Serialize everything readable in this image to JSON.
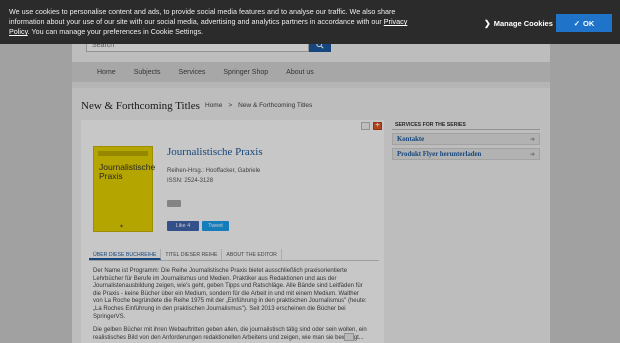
{
  "cookie": {
    "text_before_link": "We use cookies to personalise content and ads, to provide social media features and to analyse our traffic. We also share information about your use of our site with our social media, advertising and analytics partners in accordance with our ",
    "link": "Privacy Policy",
    "text_after_link": ". You can manage your preferences in Cookie Settings.",
    "manage_label": "Manage Cookies",
    "ok_label": "OK",
    "ok_color": "#1f73c9"
  },
  "search": {
    "placeholder": "Search"
  },
  "nav": [
    "Home",
    "Subjects",
    "Services",
    "Springer Shop",
    "About us"
  ],
  "page_title": "New & Forthcoming Titles",
  "breadcrumb": {
    "home": "Home",
    "sep": ">",
    "current": "New & Forthcoming Titles"
  },
  "book": {
    "cover_title": "Journalistische Praxis",
    "title": "Journalistische Praxis",
    "editor_line": "Reihen-Hrsg.: Hooffacker, Gabriele",
    "issn": "ISSN: 2524-3128",
    "fb_label": "Like 4",
    "tweet_label": "Tweet"
  },
  "tabs": [
    "ÜBER DIESE BUCHREIHE",
    "TITEL DIESER REIHE",
    "ABOUT THE EDITOR"
  ],
  "description": {
    "p1": "Der Name ist Programm: Die Reihe Journalistische Praxis bietet ausschließlich praxisorientierte Lehrbücher für Berufe im Journalismus und Medien. Praktiker aus Redaktionen und aus der Journalistenausbildung zeigen, wie's geht, geben Tipps und Ratschläge. Alle Bände sind Leitfäden für die Praxis - keine Bücher über ein Medium, sondern für die Arbeit in und mit einem Medium. Walther von La Roche begründete die Reihe 1975 mit der „Einführung in den praktischen Journalismus\" (heute: „La Roches Einführung in den praktischen Journalismus\"). Seit 2013 erscheinen die Bücher bei SpringerVS.",
    "p2": "Die gelben Bücher mit ihren Webauftritten geben allen, die journalistisch tätig sind oder sein wollen, ein realistisches Bild von den Anforderungen redaktionellen Arbeitens und zeigen, wie man sie bewältigt..."
  },
  "sidebar": {
    "header": "SERVICES FOR THE SERIES",
    "items": [
      "Kontakte",
      "Produkt Flyer herunterladen"
    ]
  }
}
